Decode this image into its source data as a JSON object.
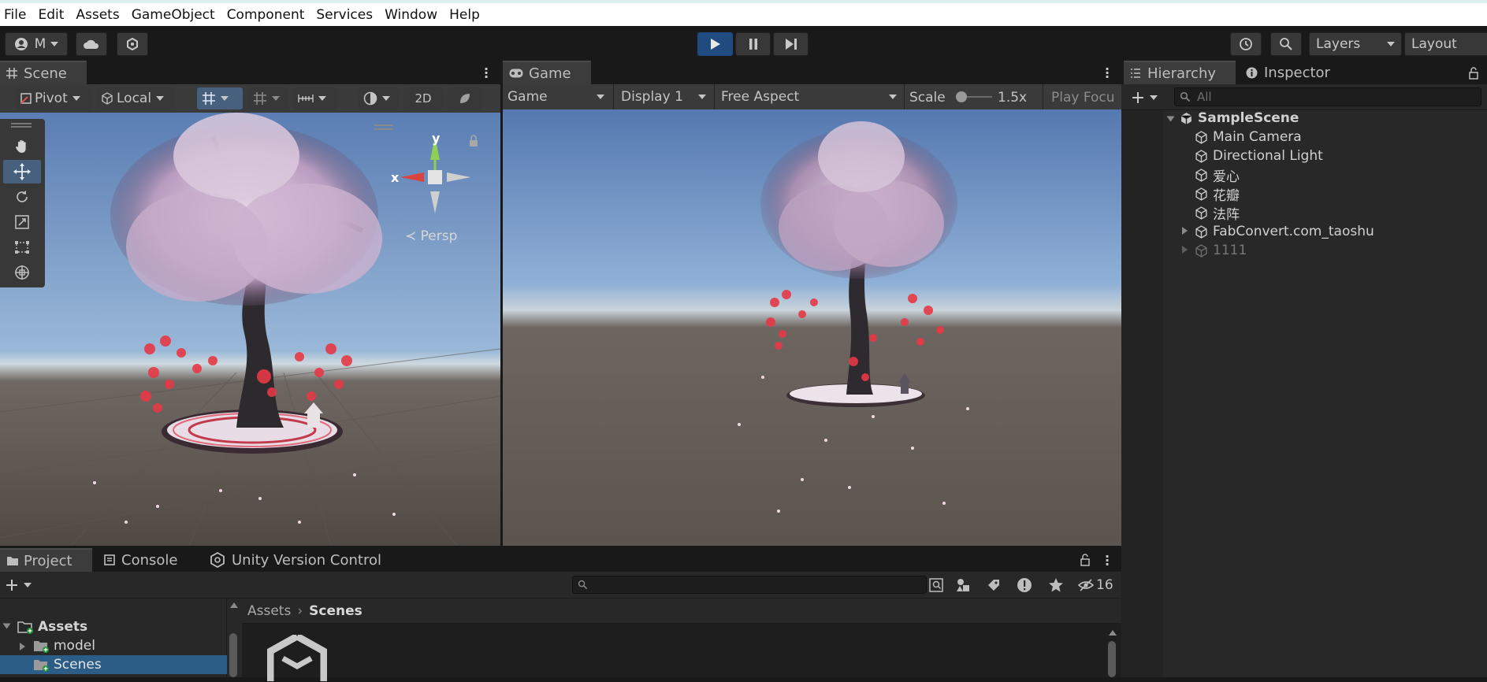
{
  "menu": [
    "File",
    "Edit",
    "Assets",
    "GameObject",
    "Component",
    "Services",
    "Window",
    "Help"
  ],
  "toolbar": {
    "account_label": "M",
    "layers_label": "Layers",
    "layout_label": "Layout"
  },
  "scene": {
    "tab": "Scene",
    "pivot": "Pivot",
    "local": "Local",
    "two_d": "2D",
    "persp": "Persp",
    "gizmo_x": "x",
    "gizmo_y": "y"
  },
  "game": {
    "tab": "Game",
    "mode": "Game",
    "display": "Display 1",
    "aspect": "Free Aspect",
    "scale_label": "Scale",
    "scale_value": "1.5x",
    "play_focus": "Play Focu"
  },
  "hierarchy": {
    "tab": "Hierarchy",
    "search_placeholder": "All",
    "scene_name": "SampleScene",
    "items": [
      "Main Camera",
      "Directional Light",
      "爱心",
      "花瓣",
      "法阵",
      "FabConvert.com_taoshu",
      "1111"
    ]
  },
  "inspector": {
    "tab": "Inspector"
  },
  "bottom": {
    "tabs": [
      "Project",
      "Console",
      "Unity Version Control"
    ],
    "hidden_count": "16",
    "tree": [
      "Assets",
      "model",
      "Scenes"
    ],
    "breadcrumb": [
      "Assets",
      "Scenes"
    ]
  }
}
